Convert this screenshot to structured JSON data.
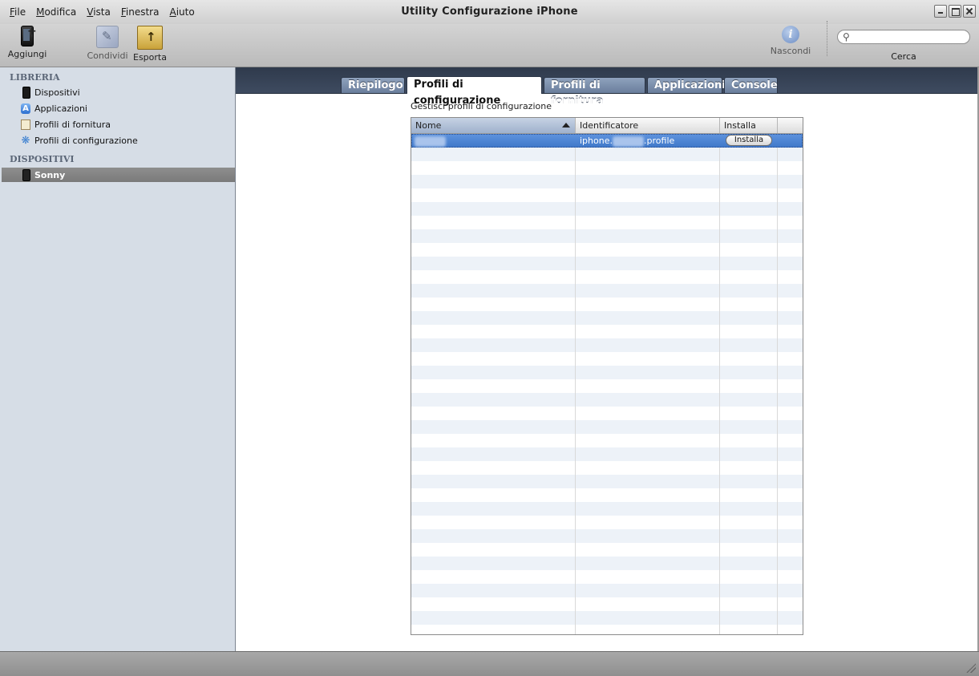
{
  "window": {
    "title": "Utility Configurazione iPhone",
    "menu": [
      "File",
      "Modifica",
      "Vista",
      "Finestra",
      "Aiuto"
    ]
  },
  "toolbar": {
    "add_label": "Aggiungi",
    "share_label": "Condividi",
    "export_label": "Esporta",
    "hide_label": "Nascondi",
    "search_label": "Cerca",
    "search_value": ""
  },
  "sidebar": {
    "library_header": "LIBRERIA",
    "library_items": [
      "Dispositivi",
      "Applicazioni",
      "Profili di fornitura",
      "Profili di configurazione"
    ],
    "devices_header": "DISPOSITIVI",
    "device_items": [
      "Sonny"
    ]
  },
  "tabs": [
    "Riepilogo",
    "Profili di configurazione",
    "Profili di fornitura",
    "Applicazioni",
    "Console"
  ],
  "active_tab": "Profili di configurazione",
  "section_title": "Gestisci profili di configurazione",
  "table": {
    "columns": [
      "Nome",
      "Identificatore",
      "Installa",
      ""
    ],
    "sort_column": "Nome",
    "rows": [
      {
        "nome_redacted": "xxxxxx",
        "id_prefix": "iphone.",
        "id_redacted": "xxxxxx",
        "id_suffix": ".profile",
        "install_label": "Installa"
      }
    ]
  },
  "colors": {
    "tabbar": "#35415a",
    "selection": "#4a82d0",
    "sidebar_bg": "#d6dde6"
  }
}
